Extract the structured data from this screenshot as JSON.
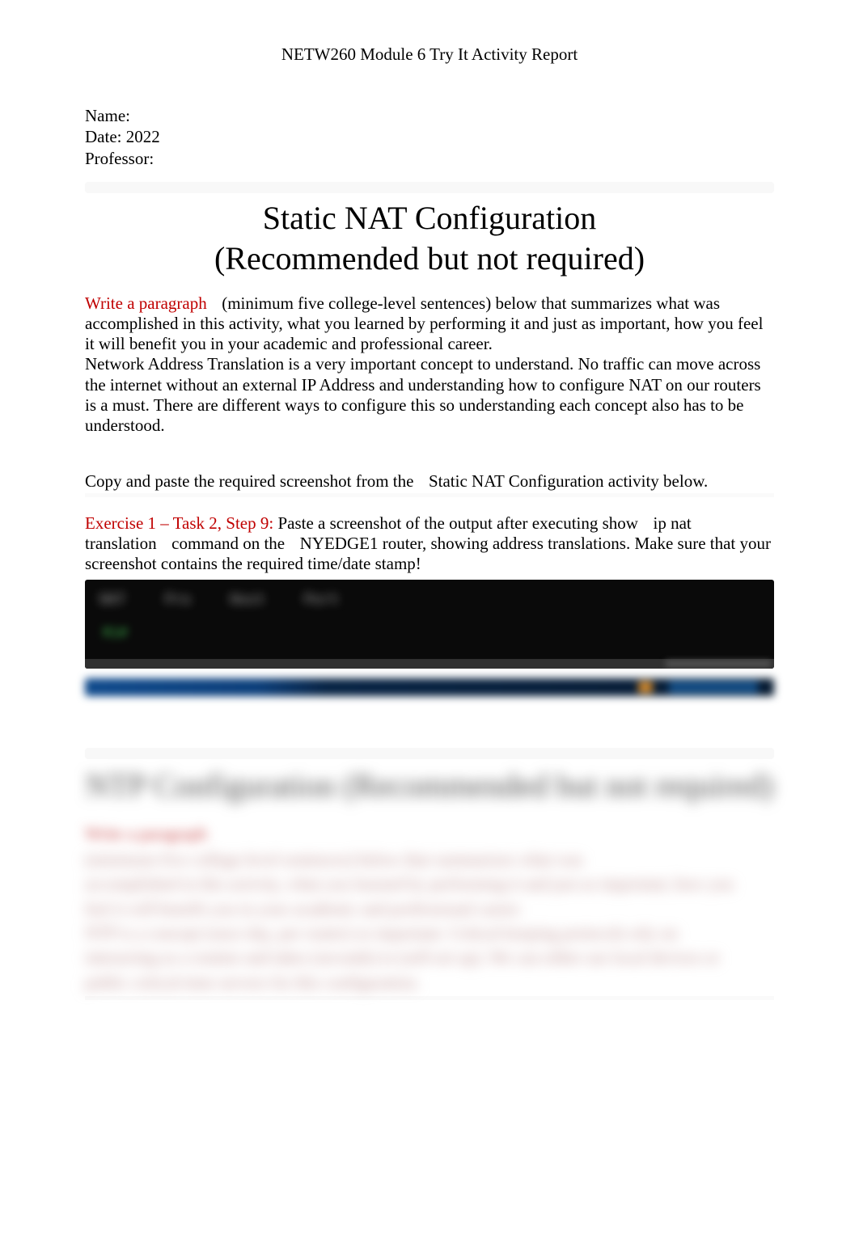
{
  "header": {
    "title": "NETW260 Module 6 Try It Activity Report"
  },
  "info": {
    "name_label": "Name:",
    "date_label": "Date: 2022",
    "prof_label": "Professor:"
  },
  "section1": {
    "title_line1": "Static NAT Configuration",
    "title_line2": "(Recommended but not required)",
    "write_label": "Write a paragraph",
    "instructions_1": "(minimum five college-level sentences) below that summarizes what was accomplished in this activity, what you learned by performing it and just as important, how you feel it will benefit you in your academic and professional career.",
    "body": "Network Address Translation is a very important concept to understand. No traffic can move across the internet without an external IP Address and understanding how to configure NAT on our routers is a must. There are different ways to configure this so understanding each concept also has to be understood.",
    "copy_paste_pre": "Copy and paste the required screenshot from the",
    "copy_paste_post": "Static NAT Configuration activity below.",
    "exercise_label": "Exercise 1 – Task 2, Step 9:",
    "exercise_text_1": "Paste a screenshot of the output after executing show",
    "exercise_ipnat": "ip nat",
    "exercise_text_2a": "translation",
    "exercise_text_2b": "command on the",
    "exercise_router": "NYEDGE1",
    "exercise_text_2c": "router, showing address translations. Make sure that your screenshot contains the required time/date stamp!"
  },
  "terminal": {
    "col1": "NAT",
    "col2": "Pro",
    "col3": "Host",
    "col4": "Port",
    "prompt": "R1#"
  },
  "section2": {
    "title_line1": "NTP Configuration",
    "title_line2": "(Recommended but not required)",
    "write_label": "Write a paragraph",
    "blurred_1": "(minimum five college-level sentences) below that summarizes what was",
    "blurred_2": "accomplished in this activity, what you learned by performing it and just as important, how you",
    "blurred_3": "feel it will benefit you in your academic and professional career.",
    "blurred_4": "NTP is a concept (once day, per router) so important. Critical keeping protocols rely on",
    "blurred_5": "interacting as a routine and takes (seconds) to (self-set up). We can either use local devices or",
    "blurred_6": "public critical-time servers for this configuration."
  }
}
